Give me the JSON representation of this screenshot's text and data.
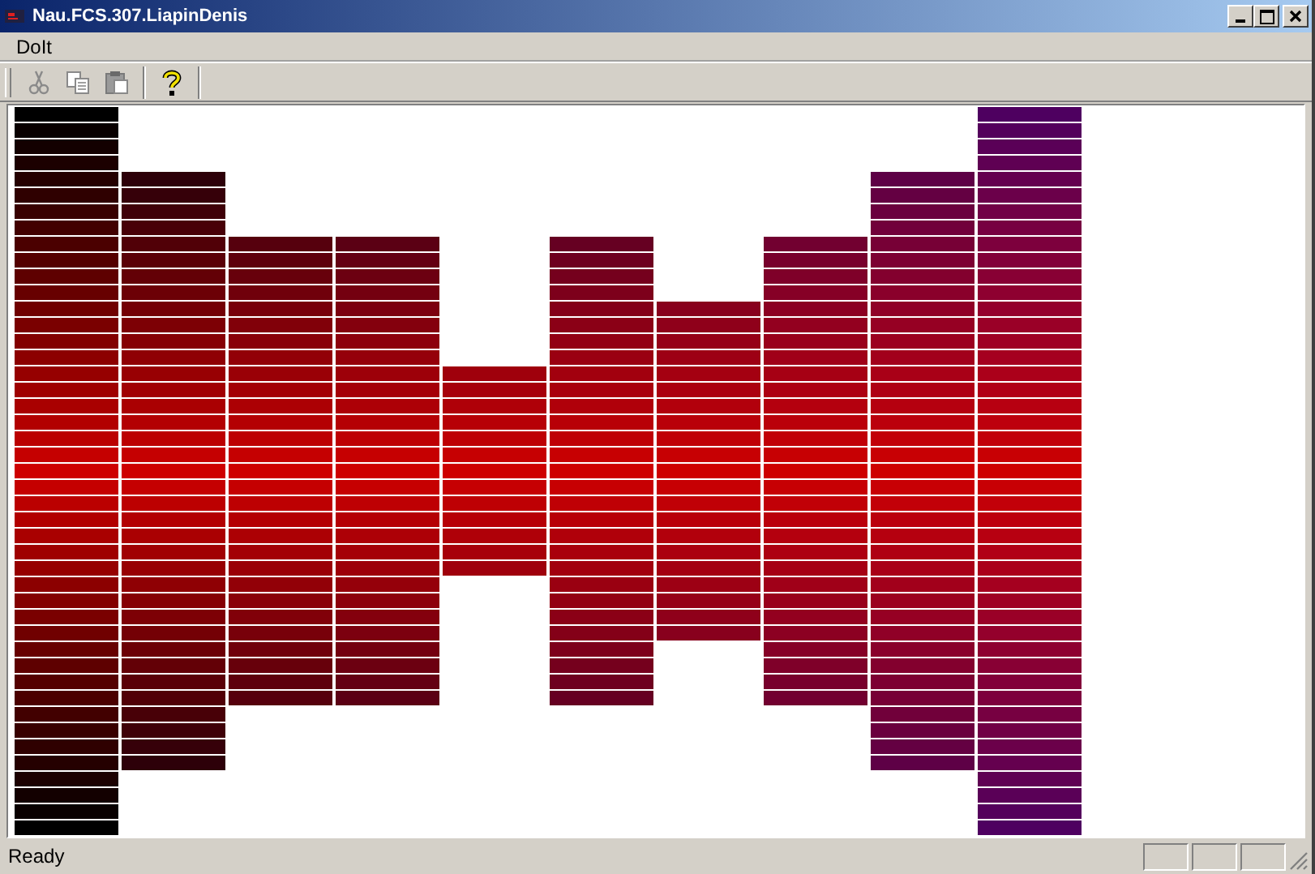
{
  "window": {
    "title": "Nau.FCS.307.LiapinDenis"
  },
  "menu": [
    {
      "label": "DoIt"
    }
  ],
  "toolbar": [
    {
      "kind": "cut",
      "disabled": true
    },
    {
      "kind": "copy",
      "disabled": true
    },
    {
      "kind": "paste",
      "disabled": true
    },
    {
      "kind": "help",
      "disabled": false
    }
  ],
  "status_bar": {
    "text": "Ready"
  }
}
